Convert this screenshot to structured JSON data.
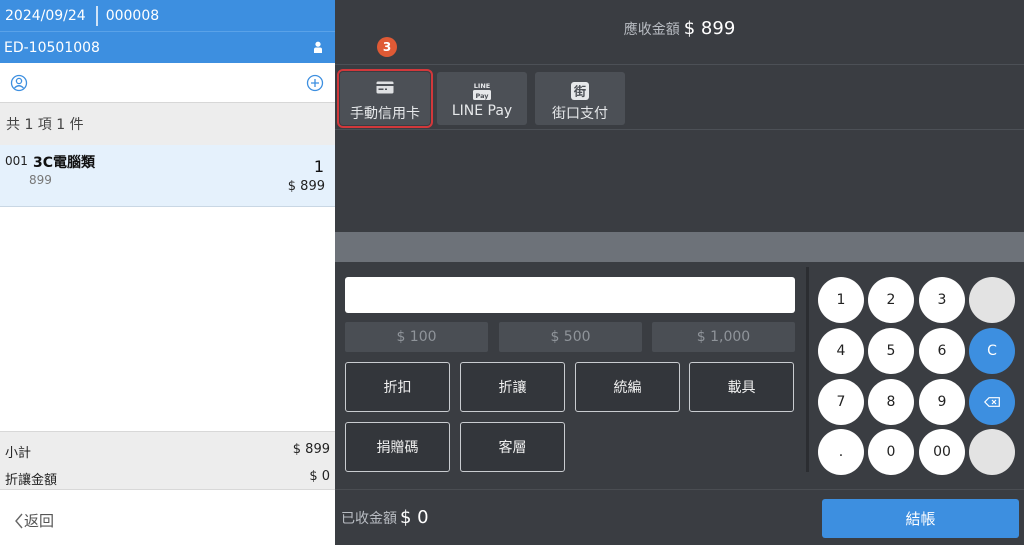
{
  "order": {
    "date": "2024/09/24",
    "number": "000008",
    "device_id": "ED-10501008",
    "count_text": "共 1 項 1 件"
  },
  "cart": {
    "items": [
      {
        "no": "001",
        "name": "3C電腦類",
        "price": "899",
        "qty": "1",
        "total": "$ 899"
      }
    ]
  },
  "summary": {
    "subtotal_label": "小計",
    "subtotal_value": "$ 899",
    "discount_label": "折讓金額",
    "discount_value": "$ 0"
  },
  "back_label": "返回",
  "amount_due": {
    "label": "應收金額",
    "value": "$ 899"
  },
  "badge_count": "3",
  "payment_methods": [
    {
      "label": "手動信用卡",
      "icon": "credit-card-icon",
      "selected": true
    },
    {
      "label": "LINE Pay",
      "icon": "line-pay-icon",
      "selected": false
    },
    {
      "label": "街口支付",
      "icon": "jkos-pay-icon",
      "selected": false
    }
  ],
  "line_pay_icon_text": {
    "top": "LINE",
    "bottom": "Pay"
  },
  "jkos_icon_text": "街",
  "amount_input": {
    "value": "",
    "placeholder": ""
  },
  "quick_amounts": [
    "$ 100",
    "$ 500",
    "$ 1,000"
  ],
  "functions": [
    "折扣",
    "折讓",
    "統編",
    "載具",
    "捐贈碼",
    "客層"
  ],
  "keypad": {
    "keys": [
      "1",
      "2",
      "3",
      "",
      "4",
      "5",
      "6",
      "C",
      "7",
      "8",
      "9",
      "",
      ".",
      "0",
      "00",
      ""
    ]
  },
  "received": {
    "label": "已收金額",
    "value": "$ 0"
  },
  "checkout_label": "結帳",
  "colors": {
    "accent": "#3d8fe0",
    "badge": "#df5a35",
    "selected_outline": "#d2383b"
  }
}
